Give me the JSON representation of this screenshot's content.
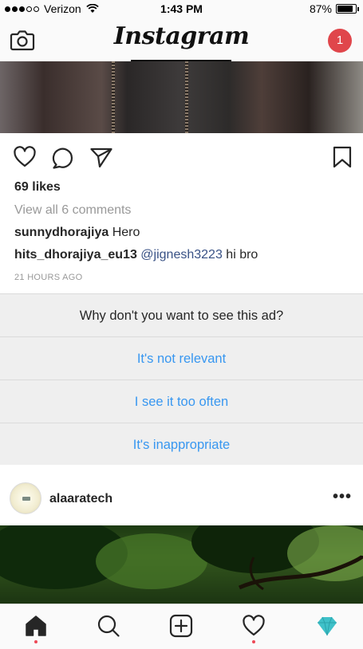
{
  "status_bar": {
    "carrier": "Verizon",
    "time": "1:43 PM",
    "battery": "87%",
    "battery_level": 0.87
  },
  "nav": {
    "logo": "Instagram",
    "notification_count": "1"
  },
  "post": {
    "likes": "69 likes",
    "view_comments": "View all 6 comments",
    "comments": [
      {
        "user": "sunnydhorajiya",
        "mention": "",
        "text": "Hero"
      },
      {
        "user": "hits_dhorajiya_eu13",
        "mention": "@jignesh3223",
        "text": "hi bro"
      }
    ],
    "timestamp": "21 HOURS AGO"
  },
  "ad_feedback": {
    "question": "Why don't you want to see this ad?",
    "options": [
      "It's not relevant",
      "I see it too often",
      "It's inappropriate"
    ]
  },
  "next_post": {
    "username": "alaaratech",
    "more": "•••"
  },
  "colors": {
    "link_blue": "#3897f0",
    "mention_blue": "#385185",
    "badge_red": "#e0464b",
    "activity_dot": "#ed4956",
    "diamond": "#3fc1c9"
  },
  "icons": [
    "camera-icon",
    "heart-icon",
    "comment-icon",
    "share-icon",
    "bookmark-icon",
    "home-icon",
    "search-icon",
    "add-icon",
    "activity-icon",
    "diamond-icon"
  ]
}
